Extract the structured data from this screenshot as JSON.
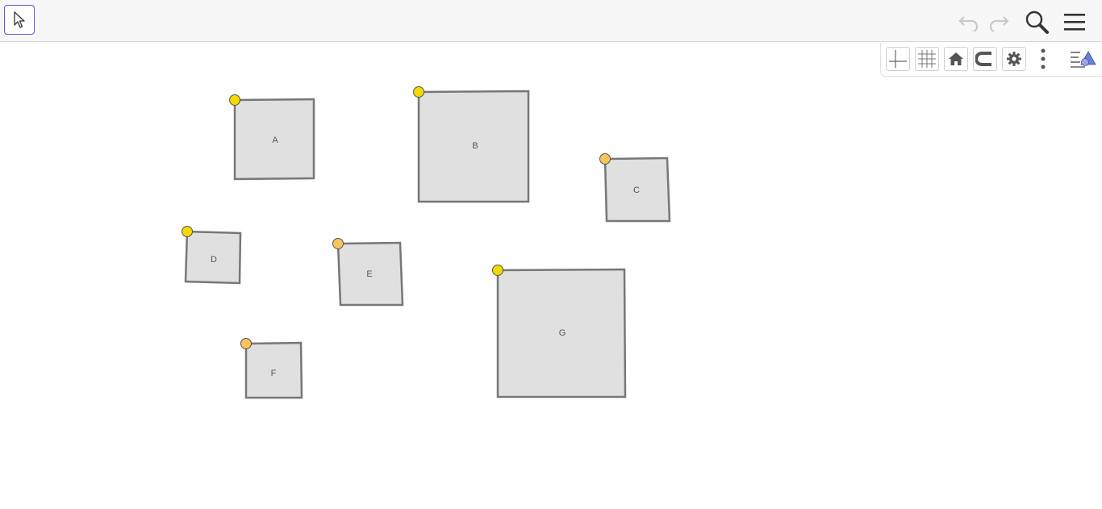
{
  "shapes": [
    {
      "label": "A"
    },
    {
      "label": "B"
    },
    {
      "label": "C"
    },
    {
      "label": "D"
    },
    {
      "label": "E"
    },
    {
      "label": "F"
    },
    {
      "label": "G"
    }
  ],
  "colors": {
    "accent": "#6557d2",
    "shape_fill": "#e0e0e0",
    "shape_stroke": "#777777",
    "point_yellow": "#f5d800",
    "point_orange": "#fdc45e"
  },
  "icons": {
    "toolbar": [
      "move-tool-icon",
      "undo-icon",
      "redo-icon",
      "search-icon",
      "menu-icon"
    ],
    "graphics": [
      "axes-icon",
      "grid-icon",
      "home-icon",
      "magnet-icon",
      "settings-icon",
      "more-icon",
      "style-bar-icon"
    ]
  }
}
